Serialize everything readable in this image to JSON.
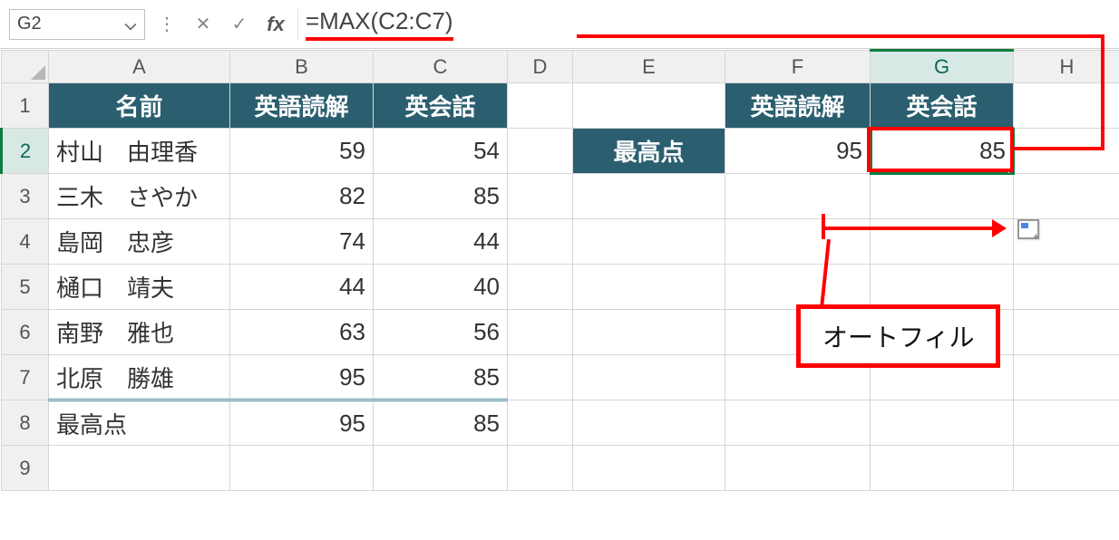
{
  "name_box": "G2",
  "formula": "=MAX(C2:C7)",
  "columns": [
    "A",
    "B",
    "C",
    "D",
    "E",
    "F",
    "G",
    "H"
  ],
  "row_numbers": [
    1,
    2,
    3,
    4,
    5,
    6,
    7,
    8,
    9
  ],
  "selected_col": "G",
  "selected_row": 2,
  "headers_left": {
    "A": "名前",
    "B": "英語読解",
    "C": "英会話"
  },
  "headers_right": {
    "F": "英語読解",
    "G": "英会話"
  },
  "rows": [
    {
      "name": "村山　由理香",
      "b": 59,
      "c": 54
    },
    {
      "name": "三木　さやか",
      "b": 82,
      "c": 85
    },
    {
      "name": "島岡　忠彦",
      "b": 74,
      "c": 44
    },
    {
      "name": "樋口　靖夫",
      "b": 44,
      "c": 40
    },
    {
      "name": "南野　雅也",
      "b": 63,
      "c": 56
    },
    {
      "name": "北原　勝雄",
      "b": 95,
      "c": 85
    }
  ],
  "summary_row": {
    "label": "最高点",
    "b": 95,
    "c": 85
  },
  "right_block": {
    "label": "最高点",
    "f": 95,
    "g": 85
  },
  "annotation": {
    "autofill": "オートフィル"
  },
  "icons": {
    "caret": "⌄",
    "cancel": "✕",
    "enter": "✓",
    "fx": "fx",
    "divider": "⋮"
  }
}
